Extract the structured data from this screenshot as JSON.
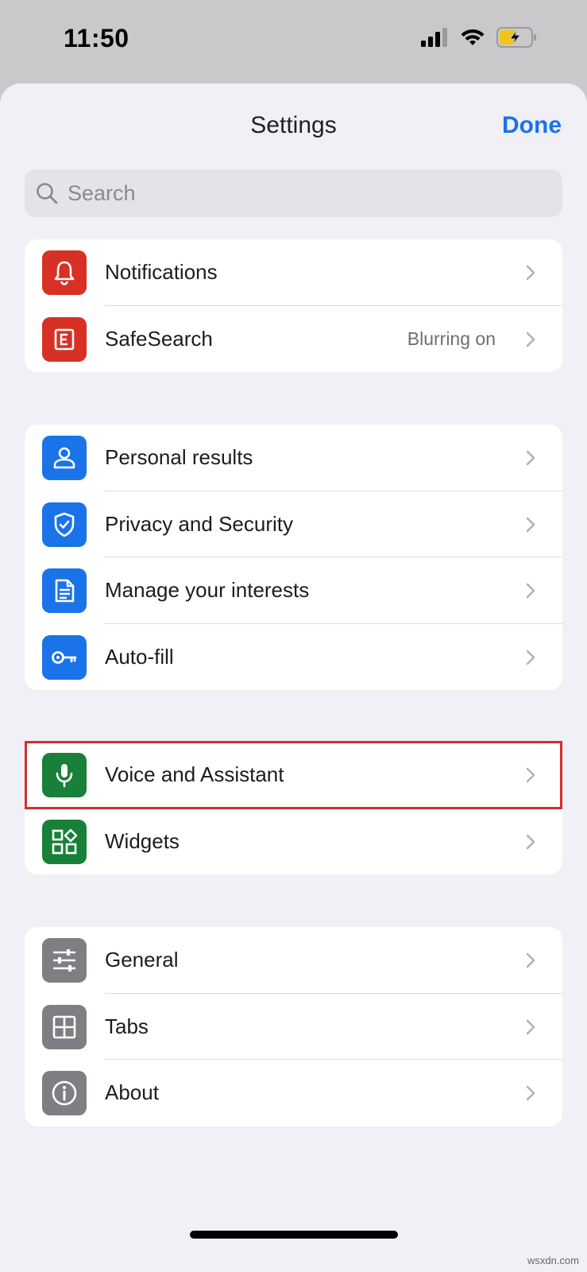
{
  "status_bar": {
    "time": "11:50"
  },
  "header": {
    "title": "Settings",
    "done_label": "Done"
  },
  "search": {
    "placeholder": "Search"
  },
  "groups": [
    {
      "items": [
        {
          "label": "Notifications",
          "icon": "bell-icon",
          "color": "#d93025"
        },
        {
          "label": "SafeSearch",
          "value": "Blurring on",
          "icon": "safesearch-icon",
          "color": "#d93025"
        }
      ]
    },
    {
      "items": [
        {
          "label": "Personal results",
          "icon": "person-icon",
          "color": "#1a73e8"
        },
        {
          "label": "Privacy and Security",
          "icon": "shield-icon",
          "color": "#1a73e8"
        },
        {
          "label": "Manage your interests",
          "icon": "document-icon",
          "color": "#1a73e8"
        },
        {
          "label": "Auto-fill",
          "icon": "key-icon",
          "color": "#1a73e8"
        }
      ]
    },
    {
      "items": [
        {
          "label": "Voice and Assistant",
          "icon": "microphone-icon",
          "color": "#188038",
          "highlighted": true
        },
        {
          "label": "Widgets",
          "icon": "widgets-icon",
          "color": "#188038"
        }
      ]
    },
    {
      "items": [
        {
          "label": "General",
          "icon": "sliders-icon",
          "color": "#7d7f83"
        },
        {
          "label": "Tabs",
          "icon": "tabs-grid-icon",
          "color": "#7d7f83"
        },
        {
          "label": "About",
          "icon": "info-icon",
          "color": "#7d7f83"
        }
      ]
    }
  ],
  "watermark": "wsxdn.com"
}
